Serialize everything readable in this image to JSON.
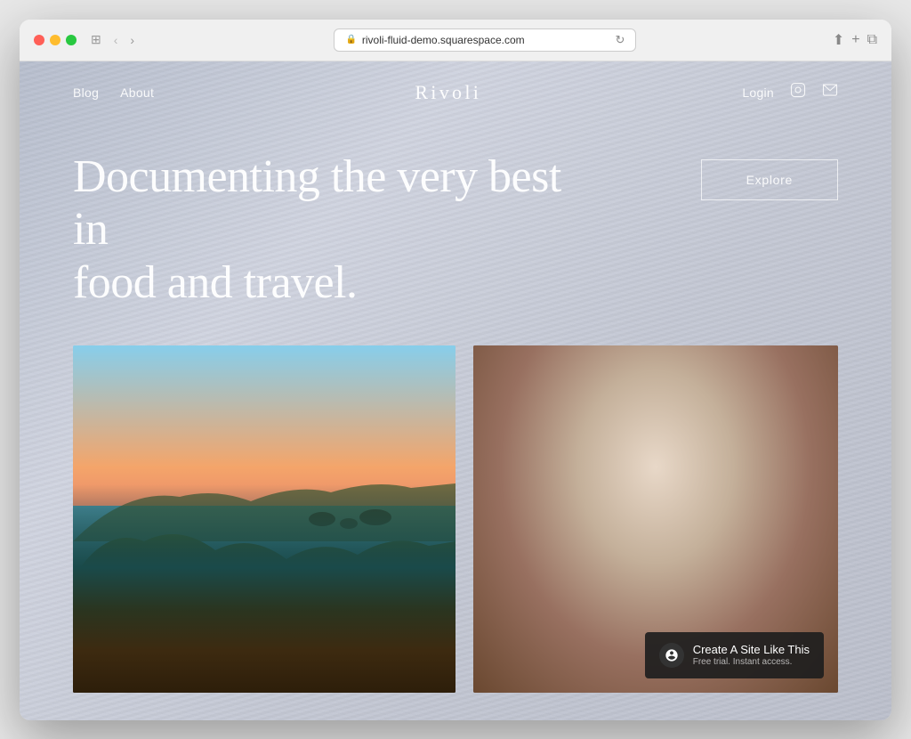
{
  "browser": {
    "url": "rivoli-fluid-demo.squarespace.com",
    "controls": {
      "back": "‹",
      "forward": "›",
      "sidebar": "⊞",
      "reload": "↻",
      "share": "⬆",
      "new_tab": "+",
      "tab_view": "⧉"
    }
  },
  "nav": {
    "left_links": [
      {
        "label": "Blog",
        "name": "blog-link"
      },
      {
        "label": "About",
        "name": "about-link"
      }
    ],
    "logo": "Rivoli",
    "right": {
      "login_label": "Login",
      "instagram_icon": "instagram",
      "mail_icon": "mail"
    }
  },
  "hero": {
    "headline_line1": "Documenting the very best in",
    "headline_line2": "food and travel.",
    "explore_button": "Explore"
  },
  "photos": {
    "left": {
      "alt": "Coastal California cliffs at sunset",
      "description": "coastal-landscape"
    },
    "right": {
      "alt": "Coffee cup with croissant from above",
      "description": "coffee-food"
    }
  },
  "banner": {
    "main_text": "Create A Site Like This",
    "sub_text": "Free trial. Instant access."
  }
}
